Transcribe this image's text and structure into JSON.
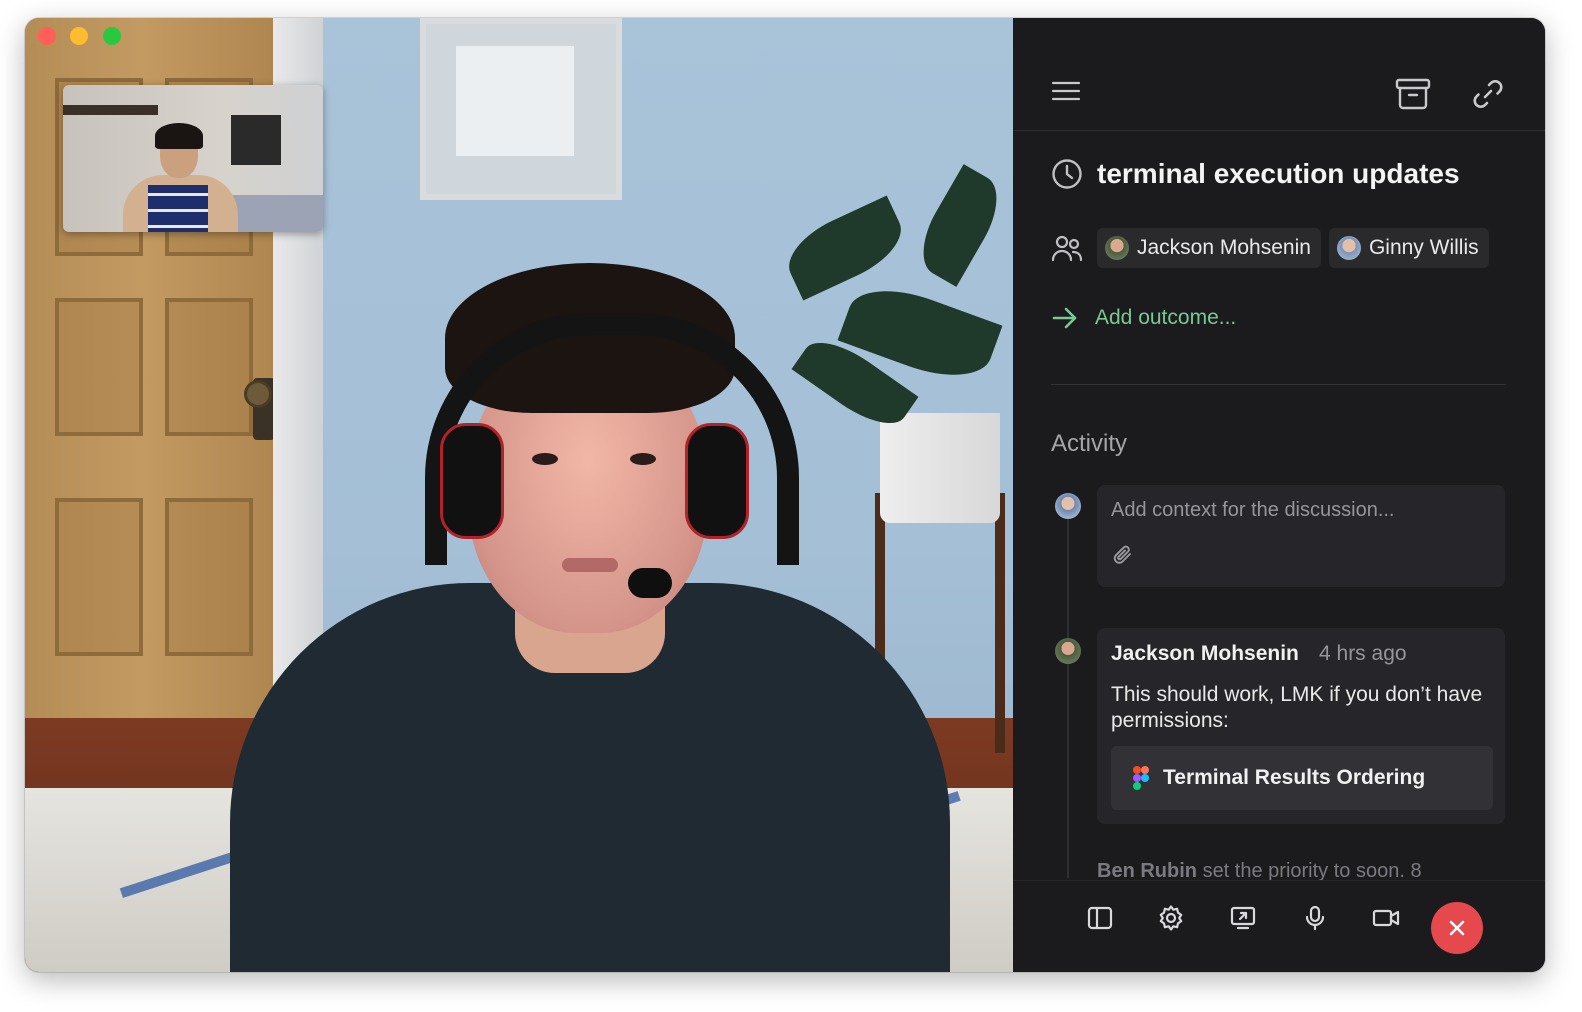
{
  "window": {
    "traffic_lights": {
      "close_color": "#ff5f57",
      "minimize_color": "#febc2e",
      "zoom_color": "#28c840"
    }
  },
  "stage": {
    "main_video_icon": "participant-video",
    "self_view_icon": "self-view-video"
  },
  "topbar": {
    "menu_icon": "menu-icon",
    "archive_icon": "archive-icon",
    "link_icon": "link-icon"
  },
  "topic": {
    "title": "terminal execution updates",
    "status_icon": "clock-icon"
  },
  "participants": {
    "icon": "people-icon",
    "items": [
      {
        "name": "Jackson Mohsenin"
      },
      {
        "name": "Ginny Willis"
      }
    ]
  },
  "outcome": {
    "label": "Add outcome...",
    "icon": "arrow-right-icon",
    "color": "#79c993"
  },
  "activity": {
    "title": "Activity",
    "input_placeholder": "Add context for the discussion...",
    "attach_icon": "paperclip-icon",
    "comment": {
      "author": "Jackson Mohsenin",
      "time": "4 hrs ago",
      "text": "This should work, LMK if you don’t have permissions:",
      "attachment": {
        "label": "Terminal Results Ordering",
        "icon": "figma-icon"
      }
    },
    "event": {
      "author": "Ben Rubin",
      "text": "set the priority to soon.",
      "time": "8"
    }
  },
  "controls": {
    "sidebar_icon": "sidebar-icon",
    "settings_icon": "gear-icon",
    "share_icon": "share-screen-icon",
    "mic_icon": "microphone-icon",
    "camera_icon": "camera-icon",
    "end_icon": "close-icon",
    "end_color": "#e5484d"
  }
}
